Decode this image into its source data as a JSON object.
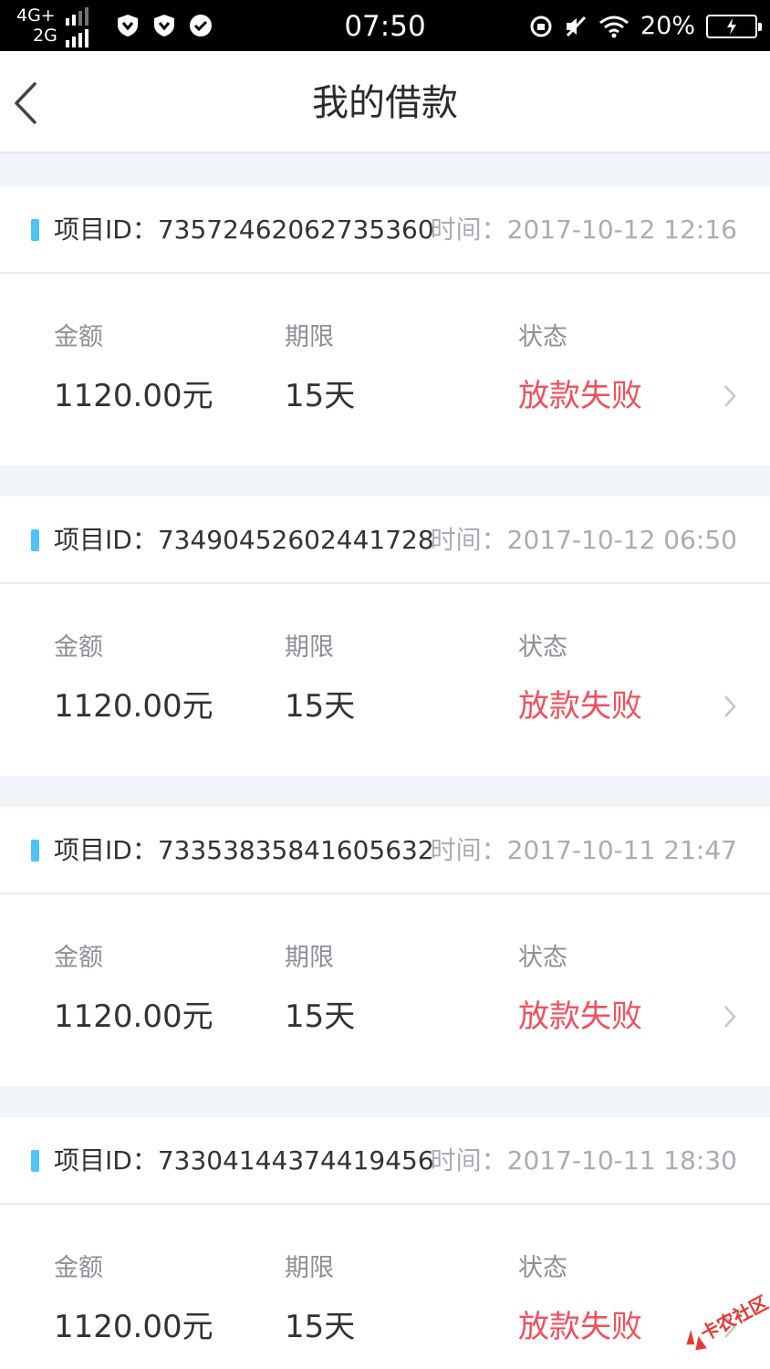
{
  "status_bar": {
    "network_top": "4G+",
    "network_bottom": "2G",
    "time": "07:50",
    "battery": "20%"
  },
  "header": {
    "title": "我的借款"
  },
  "loans": [
    {
      "project_id": "项目ID：73572462062735360",
      "time": "时间：2017-10-12 12:16",
      "amount_label": "金额",
      "amount": "1120.00元",
      "term_label": "期限",
      "term": "15天",
      "status_label": "状态",
      "status": "放款失败"
    },
    {
      "project_id": "项目ID：73490452602441728",
      "time": "时间：2017-10-12 06:50",
      "amount_label": "金额",
      "amount": "1120.00元",
      "term_label": "期限",
      "term": "15天",
      "status_label": "状态",
      "status": "放款失败"
    },
    {
      "project_id": "项目ID：73353835841605632",
      "time": "时间：2017-10-11 21:47",
      "amount_label": "金额",
      "amount": "1120.00元",
      "term_label": "期限",
      "term": "15天",
      "status_label": "状态",
      "status": "放款失败"
    },
    {
      "project_id": "项目ID：73304144374419456",
      "time": "时间：2017-10-11 18:30",
      "amount_label": "金额",
      "amount": "1120.00元",
      "term_label": "期限",
      "term": "15天",
      "status_label": "状态",
      "status": "放款失败"
    }
  ],
  "watermark": {
    "text": "卡农社区"
  },
  "colors": {
    "accent": "#4fc3f7",
    "status_failed": "#f0505c",
    "page_background": "#f1f4f8"
  }
}
